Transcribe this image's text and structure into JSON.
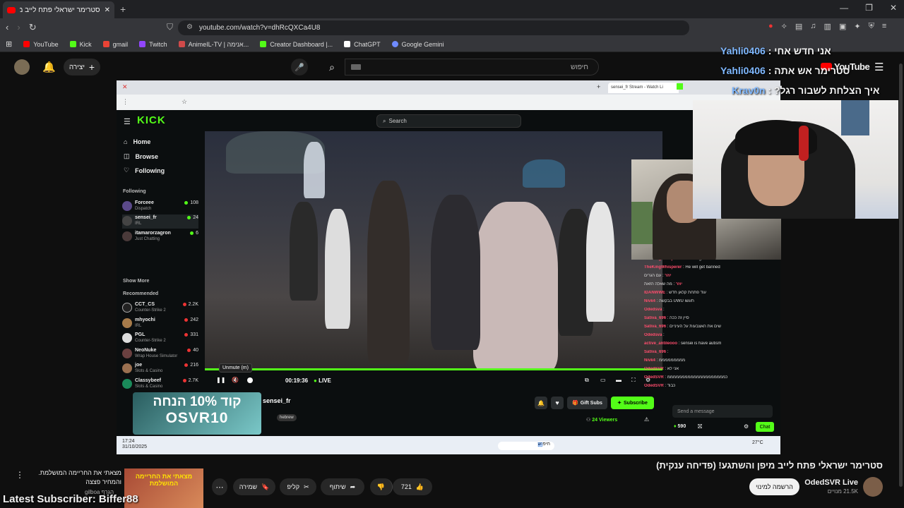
{
  "browser": {
    "tab_title": "סטרימר ישראלי פתח לייב מיפן וה",
    "new_tab": "+",
    "url": "youtube.com/watch?v=dhRcQXCa4U8",
    "bookmarks": [
      {
        "label": "YouTube",
        "color": "#ff0000"
      },
      {
        "label": "Kick",
        "color": "#53fc18"
      },
      {
        "label": "gmail",
        "color": "#ea4335"
      },
      {
        "label": "Twitch",
        "color": "#9146ff"
      },
      {
        "label": "AnimeIL-TV | אנימה...",
        "color": "#d04a4a"
      },
      {
        "label": "Creator Dashboard |...",
        "color": "#53fc18"
      },
      {
        "label": "ChatGPT",
        "color": "#ffffff"
      },
      {
        "label": "Google Gemini",
        "color": "#6f8bff"
      }
    ]
  },
  "youtube": {
    "create_label": "יצירה",
    "search_placeholder": "חיפוש",
    "logo_text": "YouTube",
    "video_title": "סטרימר ישראלי פתח לייב מיפן והשתגע! (פדיחה ענקית)",
    "channel_name": "OdedSVR Live",
    "channel_subs": "21.5K מנויים",
    "join_label": "הרשמה למינוי",
    "like_count": "721",
    "share_label": "שיתוף",
    "clip_label": "קליפ",
    "save_label": "שמירה",
    "rec_title": "מצאתי את החריימה המושלמת. והמחיר פצצה",
    "rec_channel": "gilboa הגרף",
    "rec_thumb_text": "מצאתי את החריימה המושלמת"
  },
  "overlay": {
    "chat": [
      {
        "name": "Yahli0406",
        "msg": "אני חדש אחי"
      },
      {
        "name": "Yahli0406",
        "msg": "סטרימר אש אתה"
      },
      {
        "name": "Krav0n",
        "msg": "?איך הצלחת לשבור רגל"
      }
    ],
    "latest_subscriber": "Latest Subscriber: Biffer88"
  },
  "kick": {
    "search_placeholder": "Search",
    "nav": [
      "Home",
      "Browse",
      "Following"
    ],
    "following_header": "Following",
    "show_more": "Show More",
    "recommended_header": "Recommended",
    "following": [
      {
        "name": "Forceee",
        "cat": "Dispatch",
        "viewers": "108"
      },
      {
        "name": "sensei_fr",
        "cat": "IRL",
        "viewers": "24"
      },
      {
        "name": "itamarorzagron",
        "cat": "Just Chatting",
        "viewers": "6"
      }
    ],
    "recommended": [
      {
        "name": "CCT_CS",
        "cat": "Counter-Strike 2",
        "viewers": "2.2K"
      },
      {
        "name": "mhyochi",
        "cat": "IRL",
        "viewers": "242"
      },
      {
        "name": "PGL",
        "cat": "Counter-Strike 2",
        "viewers": "331"
      },
      {
        "name": "NeoNuke",
        "cat": "Wrap House Simulator",
        "viewers": "40"
      },
      {
        "name": "joe",
        "cat": "Slots & Casino",
        "viewers": "216"
      },
      {
        "name": "Classybeef",
        "cat": "Slots & Casino",
        "viewers": "2.7K"
      }
    ],
    "player": {
      "tooltip": "Unmute (m)",
      "time": "00:19:36",
      "live": "LIVE"
    },
    "streamer_name": "sensei_fr",
    "tag": "hebrew",
    "gift_subs": "Gift Subs",
    "subscribe": "Subscribe",
    "viewers": "24 Viewers",
    "send_placeholder": "Send a message",
    "points": "590",
    "chat_button": "Chat",
    "promo_line1": "קוד 10% הנחה",
    "promo_line2": "OSVR10",
    "chat": [
      {
        "user": "TheKingWhisperer",
        "msg": "He will get banned"
      },
      {
        "user": "TheKingWhisperer",
        "msg": "He will get banned"
      },
      {
        "user": "יוזר",
        "msg": "עם הגרים"
      },
      {
        "user": "יוזר",
        "msg": "מה שאלה הזאת"
      },
      {
        "user": "IDANWWE",
        "msg": "עוד פתחת קלאן חדש"
      },
      {
        "user": "Nivk4",
        "msg": "בבקשה UWU תעשו"
      },
      {
        "user": "Odedsva",
        "msg": ""
      },
      {
        "user": "Sativa_696",
        "msg": "סיין זה ככה"
      },
      {
        "user": "Sativa_696",
        "msg": "שים את האצבעות על העיניים"
      },
      {
        "user": "Odedsva",
        "msg": ""
      },
      {
        "user": "active_antileooo",
        "msg": "sensei is have autism"
      },
      {
        "user": "Sativa_696",
        "msg": ""
      },
      {
        "user": "Nivk4",
        "msg": "מממממממממ"
      },
      {
        "user": "OdedSVR",
        "msg": "אני לא"
      },
      {
        "user": "OdedSVR",
        "msg": "כממממממממממממממממממממ"
      },
      {
        "user": "OdedSVR",
        "msg": "כבוד"
      }
    ],
    "taskbar_time": "17:24",
    "taskbar_date": "31/10/2025",
    "taskbar_search": "חיפוש",
    "weather": "27°C"
  }
}
